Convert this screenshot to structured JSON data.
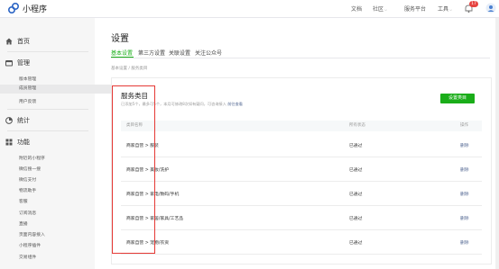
{
  "app": {
    "title": "小程序",
    "nav": [
      "文档",
      "社区",
      "服务平台",
      "工具"
    ],
    "nav_dropdown": [
      false,
      true,
      false,
      true
    ],
    "notification_count": "17",
    "accent_color": "#1aad19",
    "link_color": "#576b95"
  },
  "sidebar": {
    "home": "首页",
    "manage": "管理",
    "manage_items": [
      "版本管理",
      "成员管理",
      "用户反馈"
    ],
    "stats": "统计",
    "features": "功能",
    "feature_items": [
      "附近的小程序",
      "微信搜一搜",
      "微信支付",
      "物流助手",
      "客服",
      "订阅消息",
      "直播",
      "页面内容接入",
      "小程序插件",
      "交易组件"
    ]
  },
  "page": {
    "title": "设置",
    "tabs": [
      "基本设置",
      "第三方设置",
      "关联设置",
      "关注公众号"
    ],
    "breadcrumb": "基本设置 / 服务类目"
  },
  "service_category": {
    "title": "服务类目",
    "desc": "已添加5个，最多可5个，本月可修改8次如有疑问，可咨询接入",
    "desc_link": "前往查看",
    "set_button": "设置类目",
    "columns": [
      "类目名称",
      "所有状态",
      "操作"
    ],
    "rows": [
      {
        "category": "商家自营 > 服装",
        "status": "已通过",
        "action": "删除"
      },
      {
        "category": "商家自营 > 美妆/洗护",
        "status": "已通过",
        "action": "删除"
      },
      {
        "category": "商家自营 > 家电/数码/手机",
        "status": "已通过",
        "action": "删除"
      },
      {
        "category": "商家自营 > 家居/家具/工艺品",
        "status": "已通过",
        "action": "删除"
      },
      {
        "category": "商家自营 > 宠物/农资",
        "status": "已通过",
        "action": "删除"
      }
    ]
  }
}
